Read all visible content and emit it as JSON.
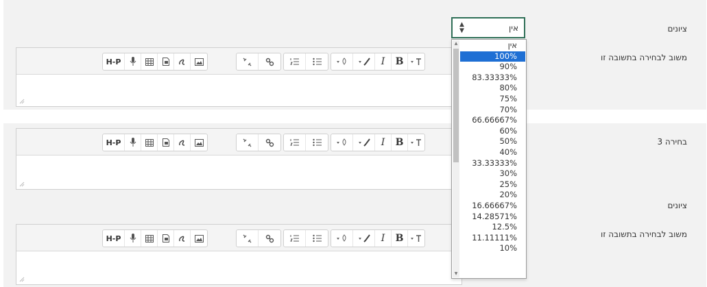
{
  "section1": {
    "grade_label": "ציונים",
    "feedback_label": "משוב לבחירה בתשובה זו"
  },
  "section2": {
    "choice_label": "בחירה 3",
    "grade_label": "ציונים",
    "feedback_label": "משוב לבחירה בתשובה זו"
  },
  "toolbar": {
    "bold": "B",
    "italic": "I",
    "h5p": "H-P",
    "icons": [
      "h5p-icon",
      "microphone-icon",
      "table-icon",
      "media-icon",
      "manage-files-icon",
      "image-icon",
      "unlink-icon",
      "link-icon",
      "ordered-list-icon",
      "unordered-list-icon",
      "drop-icon",
      "paint-brush-icon",
      "italic-icon",
      "bold-icon",
      "text-style-icon"
    ]
  },
  "grade_select": {
    "value": "אין",
    "options": [
      "אין",
      "100%",
      "90%",
      "83.33333%",
      "80%",
      "75%",
      "70%",
      "66.66667%",
      "60%",
      "50%",
      "40%",
      "33.33333%",
      "30%",
      "25%",
      "20%",
      "16.66667%",
      "14.28571%",
      "12.5%",
      "11.11111%",
      "10%"
    ],
    "selected_index": 1
  },
  "colors": {
    "select_border": "#2f6f57",
    "highlight": "#1e6fd4",
    "panel_bg": "#f2f2f2"
  }
}
